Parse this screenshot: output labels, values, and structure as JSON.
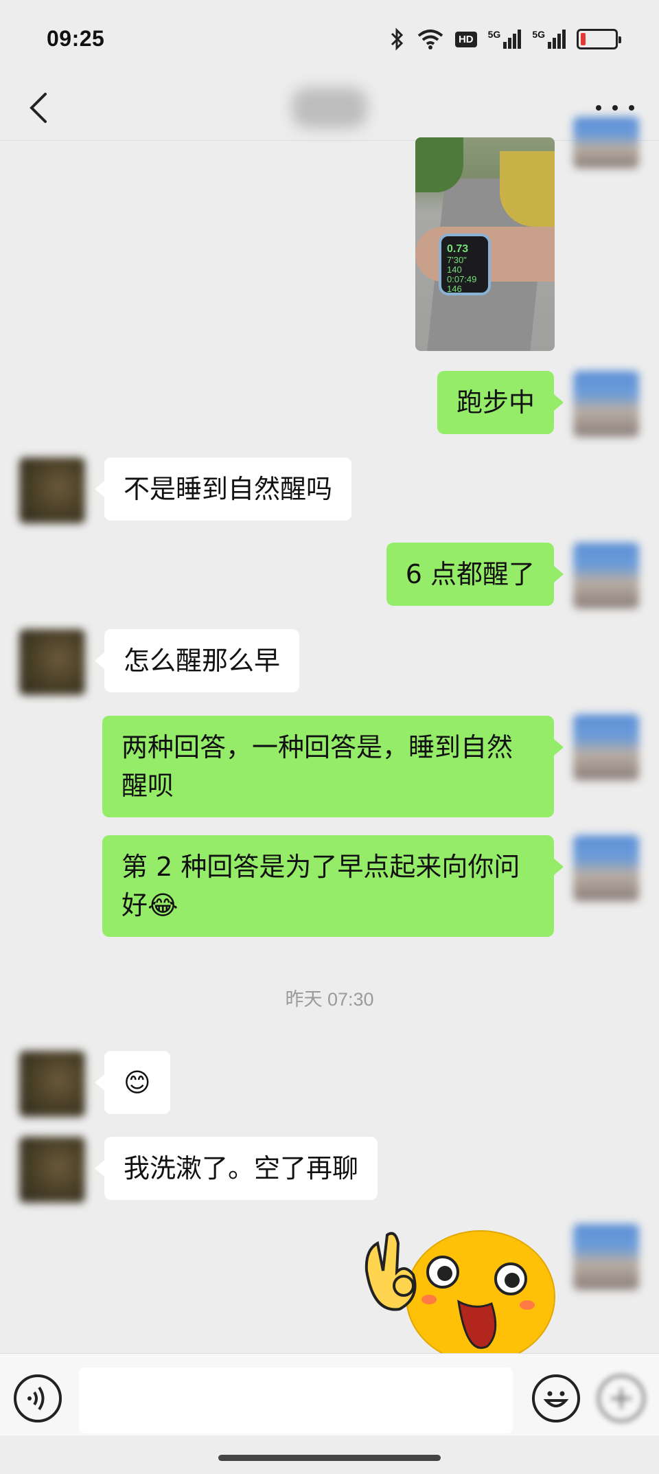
{
  "status_bar": {
    "time": "09:25",
    "icons": [
      "bluetooth-icon",
      "wifi-icon",
      "hd-voice-icon",
      "signal-5g-icon",
      "signal-5g-icon",
      "battery-icon"
    ],
    "hd_label": "HD",
    "net_label": "5G",
    "battery_level": 0.15,
    "battery_color": "#e53935"
  },
  "header": {
    "title": "",
    "back_icon": "chevron-left-icon",
    "more_icon": "more-dots-icon"
  },
  "messages": [
    {
      "id": "m0",
      "from": "self",
      "type": "image",
      "watch_lines": [
        "0.73",
        "7'30\"",
        "140",
        "0:07:49",
        "146"
      ]
    },
    {
      "id": "m1",
      "from": "self",
      "type": "text",
      "text": "跑步中"
    },
    {
      "id": "m2",
      "from": "other",
      "type": "text",
      "text": "不是睡到自然醒吗"
    },
    {
      "id": "m3",
      "from": "self",
      "type": "text",
      "text": "6 点都醒了"
    },
    {
      "id": "m4",
      "from": "other",
      "type": "text",
      "text": "怎么醒那么早"
    },
    {
      "id": "m5",
      "from": "self",
      "type": "text",
      "text": "两种回答，一种回答是，睡到自然醒呗"
    },
    {
      "id": "m6",
      "from": "self",
      "type": "text",
      "text": "第 2 种回答是为了早点起来向你问好😂"
    },
    {
      "id": "m7",
      "from": "other",
      "type": "emoji",
      "text": "😊"
    },
    {
      "id": "m8",
      "from": "other",
      "type": "text",
      "text": "我洗漱了。空了再聊"
    },
    {
      "id": "m9",
      "from": "self",
      "type": "sticker",
      "icon": "ok-hand-face-sticker-icon"
    }
  ],
  "timestamp": "昨天 07:30",
  "input_bar": {
    "voice_icon": "voice-icon",
    "emoji_icon": "emoji-icon",
    "plus_icon": "plus-icon",
    "placeholder": ""
  },
  "colors": {
    "outgoing_bubble": "#95ec69",
    "incoming_bubble": "#ffffff",
    "background": "#ededed"
  }
}
